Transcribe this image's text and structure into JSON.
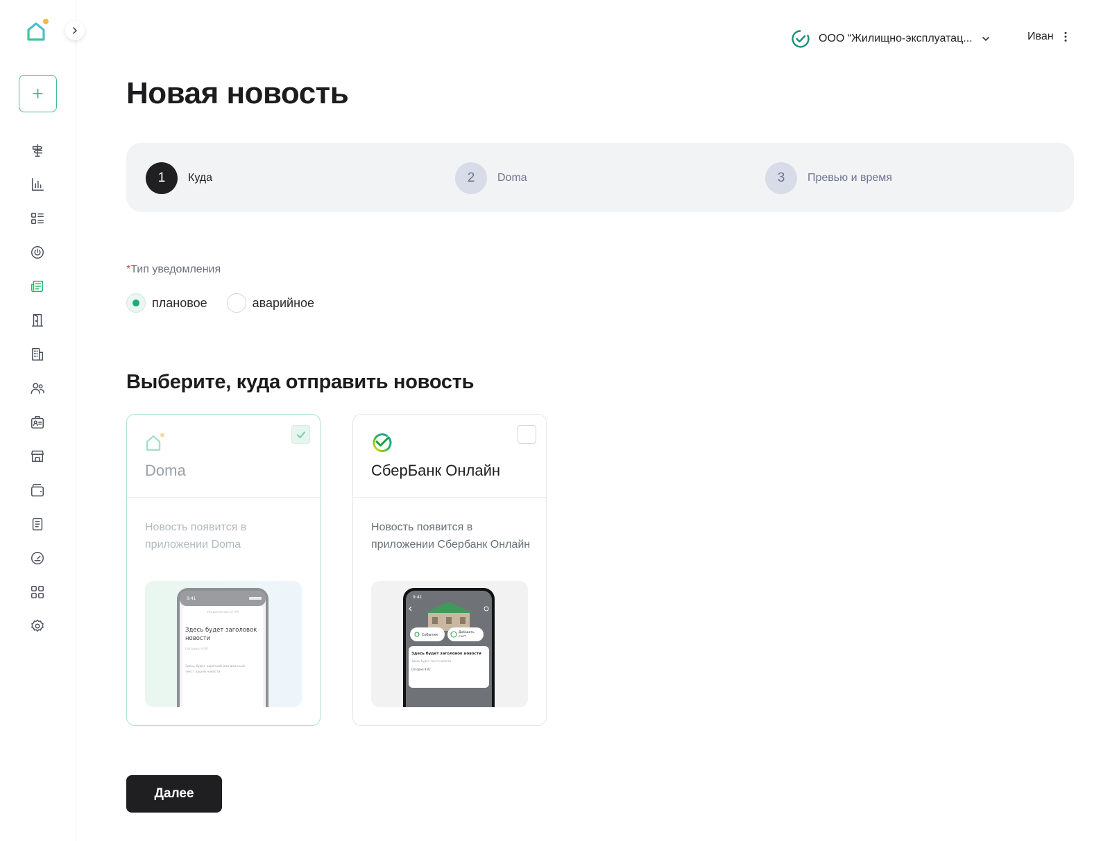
{
  "header": {
    "org_name": "ООО “Жилищно-эксплуатац...",
    "user_name": "Иван"
  },
  "page": {
    "title": "Новая новость"
  },
  "steps": [
    {
      "number": "1",
      "label": "Куда",
      "state": "current"
    },
    {
      "number": "2",
      "label": "Doma",
      "state": "upcoming"
    },
    {
      "number": "3",
      "label": "Превью и время",
      "state": "upcoming"
    }
  ],
  "notification_type": {
    "required_mark": "*",
    "label": "Тип уведомления",
    "options": [
      {
        "label": "плановое",
        "checked": true
      },
      {
        "label": "аварийное",
        "checked": false
      }
    ]
  },
  "destination": {
    "title": "Выберите, куда отправить новость",
    "cards": [
      {
        "name": "Doma",
        "checked": true,
        "description": "Новость появится в приложении Doma",
        "preview": {
          "time": "9:41",
          "subheading": "Уведомление от УК",
          "headline": "Здесь будет заголовок новости",
          "date": "Сегодня, 9:00",
          "body": "Здесь будет короткий или длинный текст вашей новости"
        }
      },
      {
        "name": "СберБанк Онлайн",
        "checked": false,
        "description": "Новость появится в приложении Сбербанк Онлайн",
        "preview": {
          "time": "9:41",
          "chip_events": "События",
          "chip_add_bill": "Добавить счет",
          "headline": "Здесь будет заголовок новости",
          "body": "Здесь будет текст новости",
          "date": "Сегодня 9:02"
        }
      }
    ]
  },
  "actions": {
    "next_label": "Далее"
  },
  "colors": {
    "accent_green": "#2bb36f",
    "dark": "#1f1f22",
    "stepper_bg": "#f2f3f5",
    "logo_dot": "#f5b942"
  },
  "sidebar": {
    "icons": [
      "signpost-icon",
      "chart-icon",
      "list-icon",
      "power-icon",
      "news-icon",
      "door-icon",
      "building-icon",
      "users-icon",
      "id-card-icon",
      "store-icon",
      "wallet-icon",
      "document-icon",
      "gauge-icon",
      "apps-icon",
      "gear-icon"
    ],
    "active": "news-icon"
  }
}
